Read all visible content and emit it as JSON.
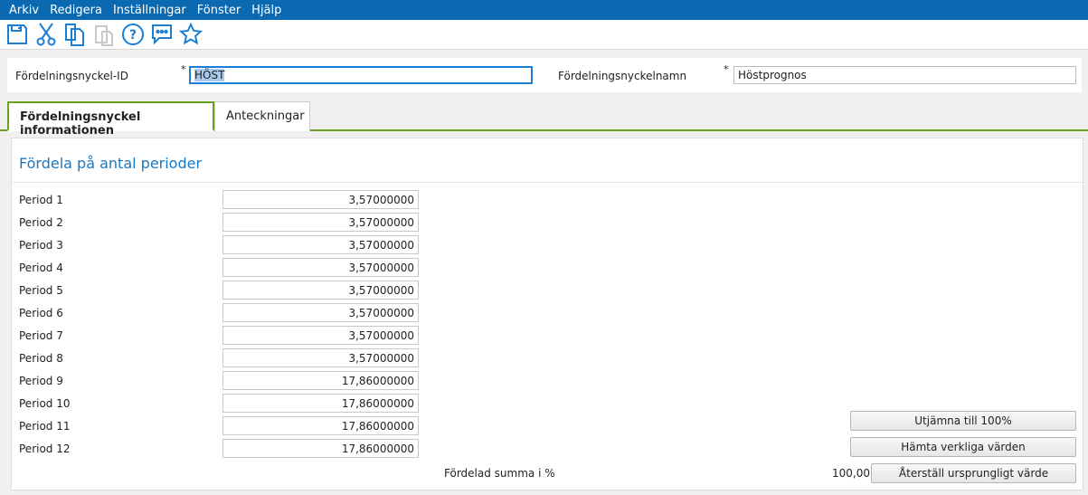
{
  "menu": [
    "Arkiv",
    "Redigera",
    "Inställningar",
    "Fönster",
    "Hjälp"
  ],
  "toolbar": [
    "save-icon",
    "cut-icon",
    "copy-icon",
    "paste-icon",
    "help-icon",
    "comment-icon",
    "favorite-icon"
  ],
  "header": {
    "id_label": "Fördelningsnyckel-ID",
    "id_value": "HÖST",
    "name_label": "Fördelningsnyckelnamn",
    "name_value": "Höstprognos",
    "required": "*"
  },
  "tabs": [
    "Fördelningsnyckel informationen",
    "Anteckningar"
  ],
  "section_title": "Fördela på antal perioder",
  "periods": [
    {
      "label": "Period 1",
      "value": "3,57000000"
    },
    {
      "label": "Period 2",
      "value": "3,57000000"
    },
    {
      "label": "Period 3",
      "value": "3,57000000"
    },
    {
      "label": "Period 4",
      "value": "3,57000000"
    },
    {
      "label": "Period 5",
      "value": "3,57000000"
    },
    {
      "label": "Period 6",
      "value": "3,57000000"
    },
    {
      "label": "Period 7",
      "value": "3,57000000"
    },
    {
      "label": "Period 8",
      "value": "3,57000000"
    },
    {
      "label": "Period 9",
      "value": "17,86000000"
    },
    {
      "label": "Period 10",
      "value": "17,86000000"
    },
    {
      "label": "Period 11",
      "value": "17,86000000"
    },
    {
      "label": "Period 12",
      "value": "17,86000000"
    }
  ],
  "sum_label": "Fördelad summa i %",
  "sum_value": "100,00",
  "buttons": {
    "equalize": "Utjämna till 100%",
    "fetch": "Hämta verkliga värden",
    "reset": "Återställ ursprungligt värde"
  }
}
